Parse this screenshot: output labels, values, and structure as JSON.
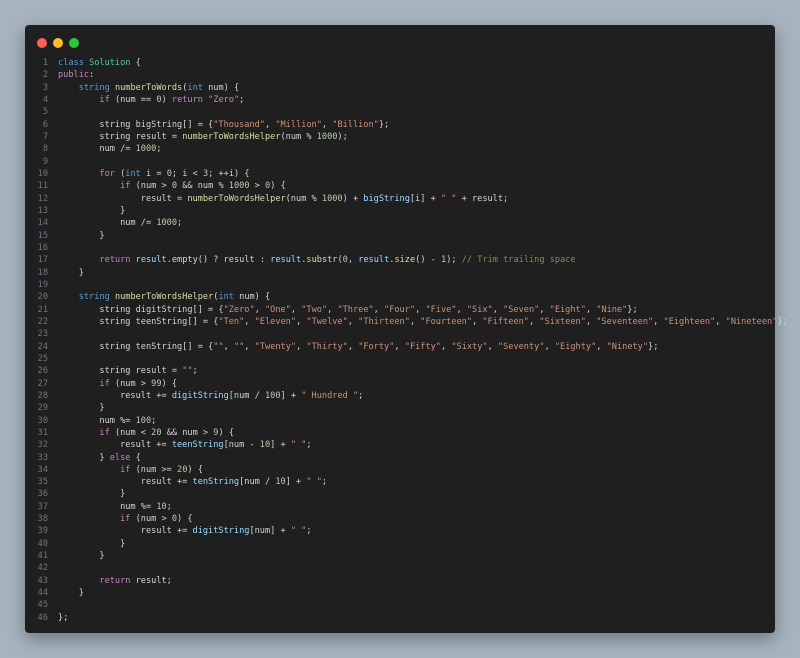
{
  "window": {
    "traffic_lights": [
      {
        "name": "close",
        "color": "#ff5f57"
      },
      {
        "name": "minimize",
        "color": "#febc2e"
      },
      {
        "name": "zoom",
        "color": "#28c840"
      }
    ]
  },
  "editor": {
    "language": "cpp",
    "lines": [
      [
        [
          "ty",
          "class"
        ],
        [
          "",
          " "
        ],
        [
          "cls",
          "Solution"
        ],
        [
          "",
          " {"
        ]
      ],
      [
        [
          "kw",
          "public"
        ],
        [
          "",
          ":"
        ]
      ],
      [
        [
          "",
          "    "
        ],
        [
          "ty",
          "string"
        ],
        [
          "",
          " "
        ],
        [
          "fn",
          "numberToWords"
        ],
        [
          "",
          "("
        ],
        [
          "ty",
          "int"
        ],
        [
          "",
          " num) {"
        ]
      ],
      [
        [
          "",
          "        "
        ],
        [
          "kw",
          "if"
        ],
        [
          "",
          " (num == "
        ],
        [
          "num",
          "0"
        ],
        [
          "",
          ") "
        ],
        [
          "kw",
          "return"
        ],
        [
          "",
          " "
        ],
        [
          "str",
          "\"Zero\""
        ],
        [
          "",
          ";"
        ]
      ],
      [
        [
          "",
          ""
        ]
      ],
      [
        [
          "",
          "        string bigString[] = {"
        ],
        [
          "str",
          "\"Thousand\""
        ],
        [
          "",
          ", "
        ],
        [
          "str",
          "\"Million\""
        ],
        [
          "",
          ", "
        ],
        [
          "str",
          "\"Billion\""
        ],
        [
          "",
          "};"
        ]
      ],
      [
        [
          "",
          "        string result = "
        ],
        [
          "fn",
          "numberToWordsHelper"
        ],
        [
          "",
          "(num % "
        ],
        [
          "num",
          "1000"
        ],
        [
          "",
          ");"
        ]
      ],
      [
        [
          "",
          "        num /= "
        ],
        [
          "num",
          "1000"
        ],
        [
          "",
          ";"
        ]
      ],
      [
        [
          "",
          ""
        ]
      ],
      [
        [
          "",
          "        "
        ],
        [
          "kw",
          "for"
        ],
        [
          "",
          " ("
        ],
        [
          "ty",
          "int"
        ],
        [
          "",
          " i = "
        ],
        [
          "num",
          "0"
        ],
        [
          "",
          "; i < "
        ],
        [
          "num",
          "3"
        ],
        [
          "",
          "; ++i) {"
        ]
      ],
      [
        [
          "",
          "            "
        ],
        [
          "kw",
          "if"
        ],
        [
          "",
          " (num > "
        ],
        [
          "num",
          "0"
        ],
        [
          "",
          " && num % "
        ],
        [
          "num",
          "1000"
        ],
        [
          "",
          " > "
        ],
        [
          "num",
          "0"
        ],
        [
          "",
          ") {"
        ]
      ],
      [
        [
          "",
          "                result = "
        ],
        [
          "fn",
          "numberToWordsHelper"
        ],
        [
          "",
          "(num % "
        ],
        [
          "num",
          "1000"
        ],
        [
          "",
          ") + "
        ],
        [
          "var",
          "bigString"
        ],
        [
          "",
          "[i] + "
        ],
        [
          "str",
          "\" \""
        ],
        [
          "",
          " + result;"
        ]
      ],
      [
        [
          "",
          "            }"
        ]
      ],
      [
        [
          "",
          "            num /= "
        ],
        [
          "num",
          "1000"
        ],
        [
          "",
          ";"
        ]
      ],
      [
        [
          "",
          "        }"
        ]
      ],
      [
        [
          "",
          ""
        ]
      ],
      [
        [
          "",
          "        "
        ],
        [
          "kw",
          "return"
        ],
        [
          "",
          " "
        ],
        [
          "var",
          "result"
        ],
        [
          "",
          "."
        ],
        [
          "fn",
          "empty"
        ],
        [
          "",
          "() ? result : "
        ],
        [
          "var",
          "result"
        ],
        [
          "",
          "."
        ],
        [
          "fn",
          "substr"
        ],
        [
          "",
          "("
        ],
        [
          "num",
          "0"
        ],
        [
          "",
          ", "
        ],
        [
          "var",
          "result"
        ],
        [
          "",
          "."
        ],
        [
          "fn",
          "size"
        ],
        [
          "",
          "() - "
        ],
        [
          "num",
          "1"
        ],
        [
          "",
          "); "
        ],
        [
          "cm",
          "// Trim trailing space"
        ]
      ],
      [
        [
          "",
          "    }"
        ]
      ],
      [
        [
          "",
          ""
        ]
      ],
      [
        [
          "",
          "    "
        ],
        [
          "ty",
          "string"
        ],
        [
          "",
          " "
        ],
        [
          "fn",
          "numberToWordsHelper"
        ],
        [
          "",
          "("
        ],
        [
          "ty",
          "int"
        ],
        [
          "",
          " num) {"
        ]
      ],
      [
        [
          "",
          "        string digitString[] = {"
        ],
        [
          "str",
          "\"Zero\""
        ],
        [
          "",
          ", "
        ],
        [
          "str",
          "\"One\""
        ],
        [
          "",
          ", "
        ],
        [
          "str",
          "\"Two\""
        ],
        [
          "",
          ", "
        ],
        [
          "str",
          "\"Three\""
        ],
        [
          "",
          ", "
        ],
        [
          "str",
          "\"Four\""
        ],
        [
          "",
          ", "
        ],
        [
          "str",
          "\"Five\""
        ],
        [
          "",
          ", "
        ],
        [
          "str",
          "\"Six\""
        ],
        [
          "",
          ", "
        ],
        [
          "str",
          "\"Seven\""
        ],
        [
          "",
          ", "
        ],
        [
          "str",
          "\"Eight\""
        ],
        [
          "",
          ", "
        ],
        [
          "str",
          "\"Nine\""
        ],
        [
          "",
          "};"
        ]
      ],
      [
        [
          "",
          "        string teenString[] = {"
        ],
        [
          "str",
          "\"Ten\""
        ],
        [
          "",
          ", "
        ],
        [
          "str",
          "\"Eleven\""
        ],
        [
          "",
          ", "
        ],
        [
          "str",
          "\"Twelve\""
        ],
        [
          "",
          ", "
        ],
        [
          "str",
          "\"Thirteen\""
        ],
        [
          "",
          ", "
        ],
        [
          "str",
          "\"Fourteen\""
        ],
        [
          "",
          ", "
        ],
        [
          "str",
          "\"Fifteen\""
        ],
        [
          "",
          ", "
        ],
        [
          "str",
          "\"Sixteen\""
        ],
        [
          "",
          ", "
        ],
        [
          "str",
          "\"Seventeen\""
        ],
        [
          "",
          ", "
        ],
        [
          "str",
          "\"Eighteen\""
        ],
        [
          "",
          ", "
        ],
        [
          "str",
          "\"Nineteen\""
        ],
        [
          "",
          "};"
        ]
      ],
      [
        [
          "",
          ""
        ]
      ],
      [
        [
          "",
          "        string tenString[] = {"
        ],
        [
          "str",
          "\"\""
        ],
        [
          "",
          ", "
        ],
        [
          "str",
          "\"\""
        ],
        [
          "",
          ", "
        ],
        [
          "str",
          "\"Twenty\""
        ],
        [
          "",
          ", "
        ],
        [
          "str",
          "\"Thirty\""
        ],
        [
          "",
          ", "
        ],
        [
          "str",
          "\"Forty\""
        ],
        [
          "",
          ", "
        ],
        [
          "str",
          "\"Fifty\""
        ],
        [
          "",
          ", "
        ],
        [
          "str",
          "\"Sixty\""
        ],
        [
          "",
          ", "
        ],
        [
          "str",
          "\"Seventy\""
        ],
        [
          "",
          ", "
        ],
        [
          "str",
          "\"Eighty\""
        ],
        [
          "",
          ", "
        ],
        [
          "str",
          "\"Ninety\""
        ],
        [
          "",
          "};"
        ]
      ],
      [
        [
          "",
          ""
        ]
      ],
      [
        [
          "",
          "        string result = "
        ],
        [
          "str",
          "\"\""
        ],
        [
          "",
          ";"
        ]
      ],
      [
        [
          "",
          "        "
        ],
        [
          "kw",
          "if"
        ],
        [
          "",
          " (num > "
        ],
        [
          "num",
          "99"
        ],
        [
          "",
          ") {"
        ]
      ],
      [
        [
          "",
          "            result += "
        ],
        [
          "var",
          "digitString"
        ],
        [
          "",
          "[num / "
        ],
        [
          "num",
          "100"
        ],
        [
          "",
          "] + "
        ],
        [
          "str",
          "\" Hundred \""
        ],
        [
          "",
          ";"
        ]
      ],
      [
        [
          "",
          "        }"
        ]
      ],
      [
        [
          "",
          "        num %= "
        ],
        [
          "num",
          "100"
        ],
        [
          "",
          ";"
        ]
      ],
      [
        [
          "",
          "        "
        ],
        [
          "kw",
          "if"
        ],
        [
          "",
          " (num < "
        ],
        [
          "num",
          "20"
        ],
        [
          "",
          " && num > "
        ],
        [
          "num",
          "9"
        ],
        [
          "",
          ") {"
        ]
      ],
      [
        [
          "",
          "            result += "
        ],
        [
          "var",
          "teenString"
        ],
        [
          "",
          "[num - "
        ],
        [
          "num",
          "10"
        ],
        [
          "",
          "] + "
        ],
        [
          "str",
          "\" \""
        ],
        [
          "",
          ";"
        ]
      ],
      [
        [
          "",
          "        } "
        ],
        [
          "kw",
          "else"
        ],
        [
          "",
          " {"
        ]
      ],
      [
        [
          "",
          "            "
        ],
        [
          "kw",
          "if"
        ],
        [
          "",
          " (num >= "
        ],
        [
          "num",
          "20"
        ],
        [
          "",
          ") {"
        ]
      ],
      [
        [
          "",
          "                result += "
        ],
        [
          "var",
          "tenString"
        ],
        [
          "",
          "[num / "
        ],
        [
          "num",
          "10"
        ],
        [
          "",
          "] + "
        ],
        [
          "str",
          "\" \""
        ],
        [
          "",
          ";"
        ]
      ],
      [
        [
          "",
          "            }"
        ]
      ],
      [
        [
          "",
          "            num %= "
        ],
        [
          "num",
          "10"
        ],
        [
          "",
          ";"
        ]
      ],
      [
        [
          "",
          "            "
        ],
        [
          "kw",
          "if"
        ],
        [
          "",
          " (num > "
        ],
        [
          "num",
          "0"
        ],
        [
          "",
          ") {"
        ]
      ],
      [
        [
          "",
          "                result += "
        ],
        [
          "var",
          "digitString"
        ],
        [
          "",
          "[num] + "
        ],
        [
          "str",
          "\" \""
        ],
        [
          "",
          ";"
        ]
      ],
      [
        [
          "",
          "            }"
        ]
      ],
      [
        [
          "",
          "        }"
        ]
      ],
      [
        [
          "",
          ""
        ]
      ],
      [
        [
          "",
          "        "
        ],
        [
          "kw",
          "return"
        ],
        [
          "",
          " result;"
        ]
      ],
      [
        [
          "",
          "    }"
        ]
      ],
      [
        [
          "",
          ""
        ]
      ],
      [
        [
          "",
          "};"
        ]
      ]
    ]
  }
}
